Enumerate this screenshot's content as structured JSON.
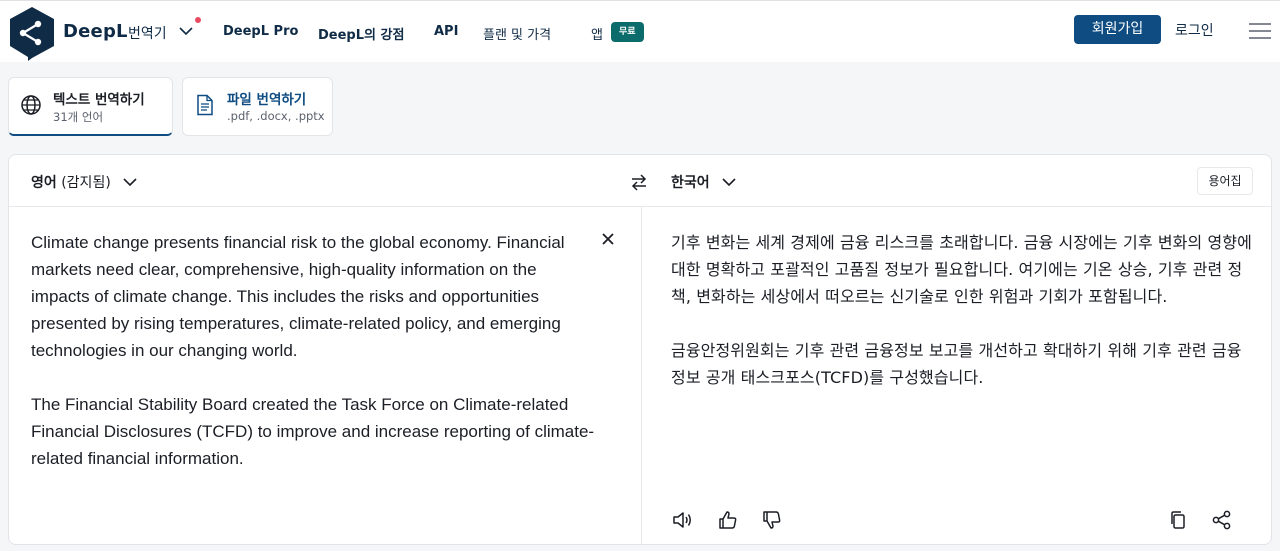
{
  "header": {
    "brand": "DeepL",
    "brand_sub": "번역기",
    "nav": [
      "DeepL Pro",
      "DeepL의 강점",
      "API",
      "플랜 및 가격",
      "앱"
    ],
    "badge": "무료",
    "signup": "회원가입",
    "login": "로그인"
  },
  "tabs": {
    "text": {
      "title": "텍스트 번역하기",
      "sub": "31개 언어"
    },
    "file": {
      "title": "파일 번역하기",
      "sub": ".pdf, .docx, .pptx"
    }
  },
  "translator": {
    "source_lang": "영어",
    "source_detected": "(감지됨)",
    "target_lang": "한국어",
    "glossary": "용어집",
    "source_paragraphs": [
      "Climate change presents financial risk to the global economy. Financial markets need clear, comprehensive, high-quality information on the impacts of climate change. This includes the risks and opportunities presented by rising temperatures, climate-related policy, and emerging technologies in our changing world.",
      "The Financial Stability Board created the Task Force on Climate-related Financial Disclosures (TCFD) to improve and increase reporting of climate-related financial information."
    ],
    "target_paragraphs": [
      "기후 변화는 세계 경제에 금융 리스크를 초래합니다. 금융 시장에는 기후 변화의 영향에 대한 명확하고 포괄적인 고품질 정보가 필요합니다. 여기에는 기온 상승, 기후 관련 정책, 변화하는 세상에서 떠오르는 신기술로 인한 위험과 기회가 포함됩니다.",
      "금융안정위원회는 기후 관련 금융정보 보고를 개선하고 확대하기 위해 기후 관련 금융정보 공개 태스크포스(TCFD)를 구성했습니다."
    ]
  },
  "colors": {
    "brand_navy": "#0f2b46",
    "primary_button": "#0f4c81",
    "badge_green": "#0c6c6b",
    "notification": "#e84a5f"
  }
}
